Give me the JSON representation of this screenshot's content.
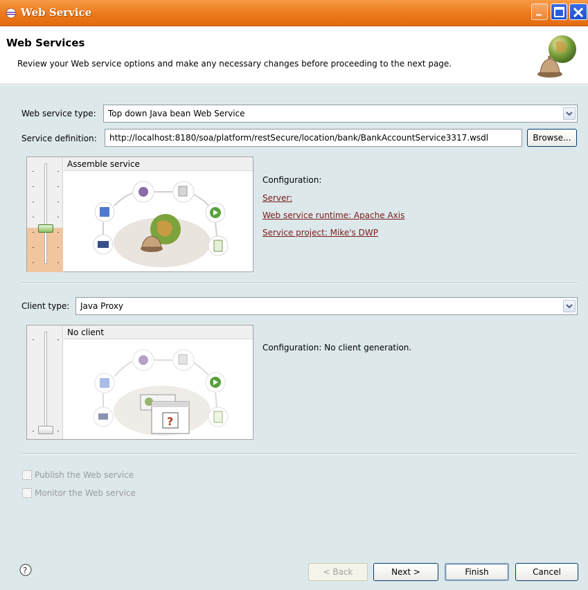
{
  "window": {
    "title": "Web Service"
  },
  "header": {
    "title": "Web Services",
    "description": "Review your Web service options and make any necessary changes before proceeding to the next page."
  },
  "service": {
    "type_label": "Web service type:",
    "type_value": "Top down Java bean Web Service",
    "definition_label": "Service definition:",
    "definition_value": "http://localhost:8180/soa/platform/restSecure/location/bank/BankAccountService3317.wsdl",
    "browse_label": "Browse...",
    "panel_title": "Assemble service",
    "config_label": "Configuration:",
    "server_link": "Server: ",
    "runtime_link": "Web service runtime: Apache Axis",
    "project_link": "Service project: Mike's DWP"
  },
  "client": {
    "type_label": "Client type:",
    "type_value": "Java Proxy",
    "panel_title": "No client",
    "config_text": "Configuration: No client generation."
  },
  "options": {
    "publish_label": "Publish the Web service",
    "monitor_label": "Monitor the Web service"
  },
  "footer": {
    "help_icon": "help-icon",
    "back_label": "< Back",
    "next_label": "Next >",
    "finish_label": "Finish",
    "cancel_label": "Cancel"
  },
  "colors": {
    "titlebar": "#ee7b1e",
    "background": "#dde8ea",
    "link": "#7a1a1a"
  }
}
